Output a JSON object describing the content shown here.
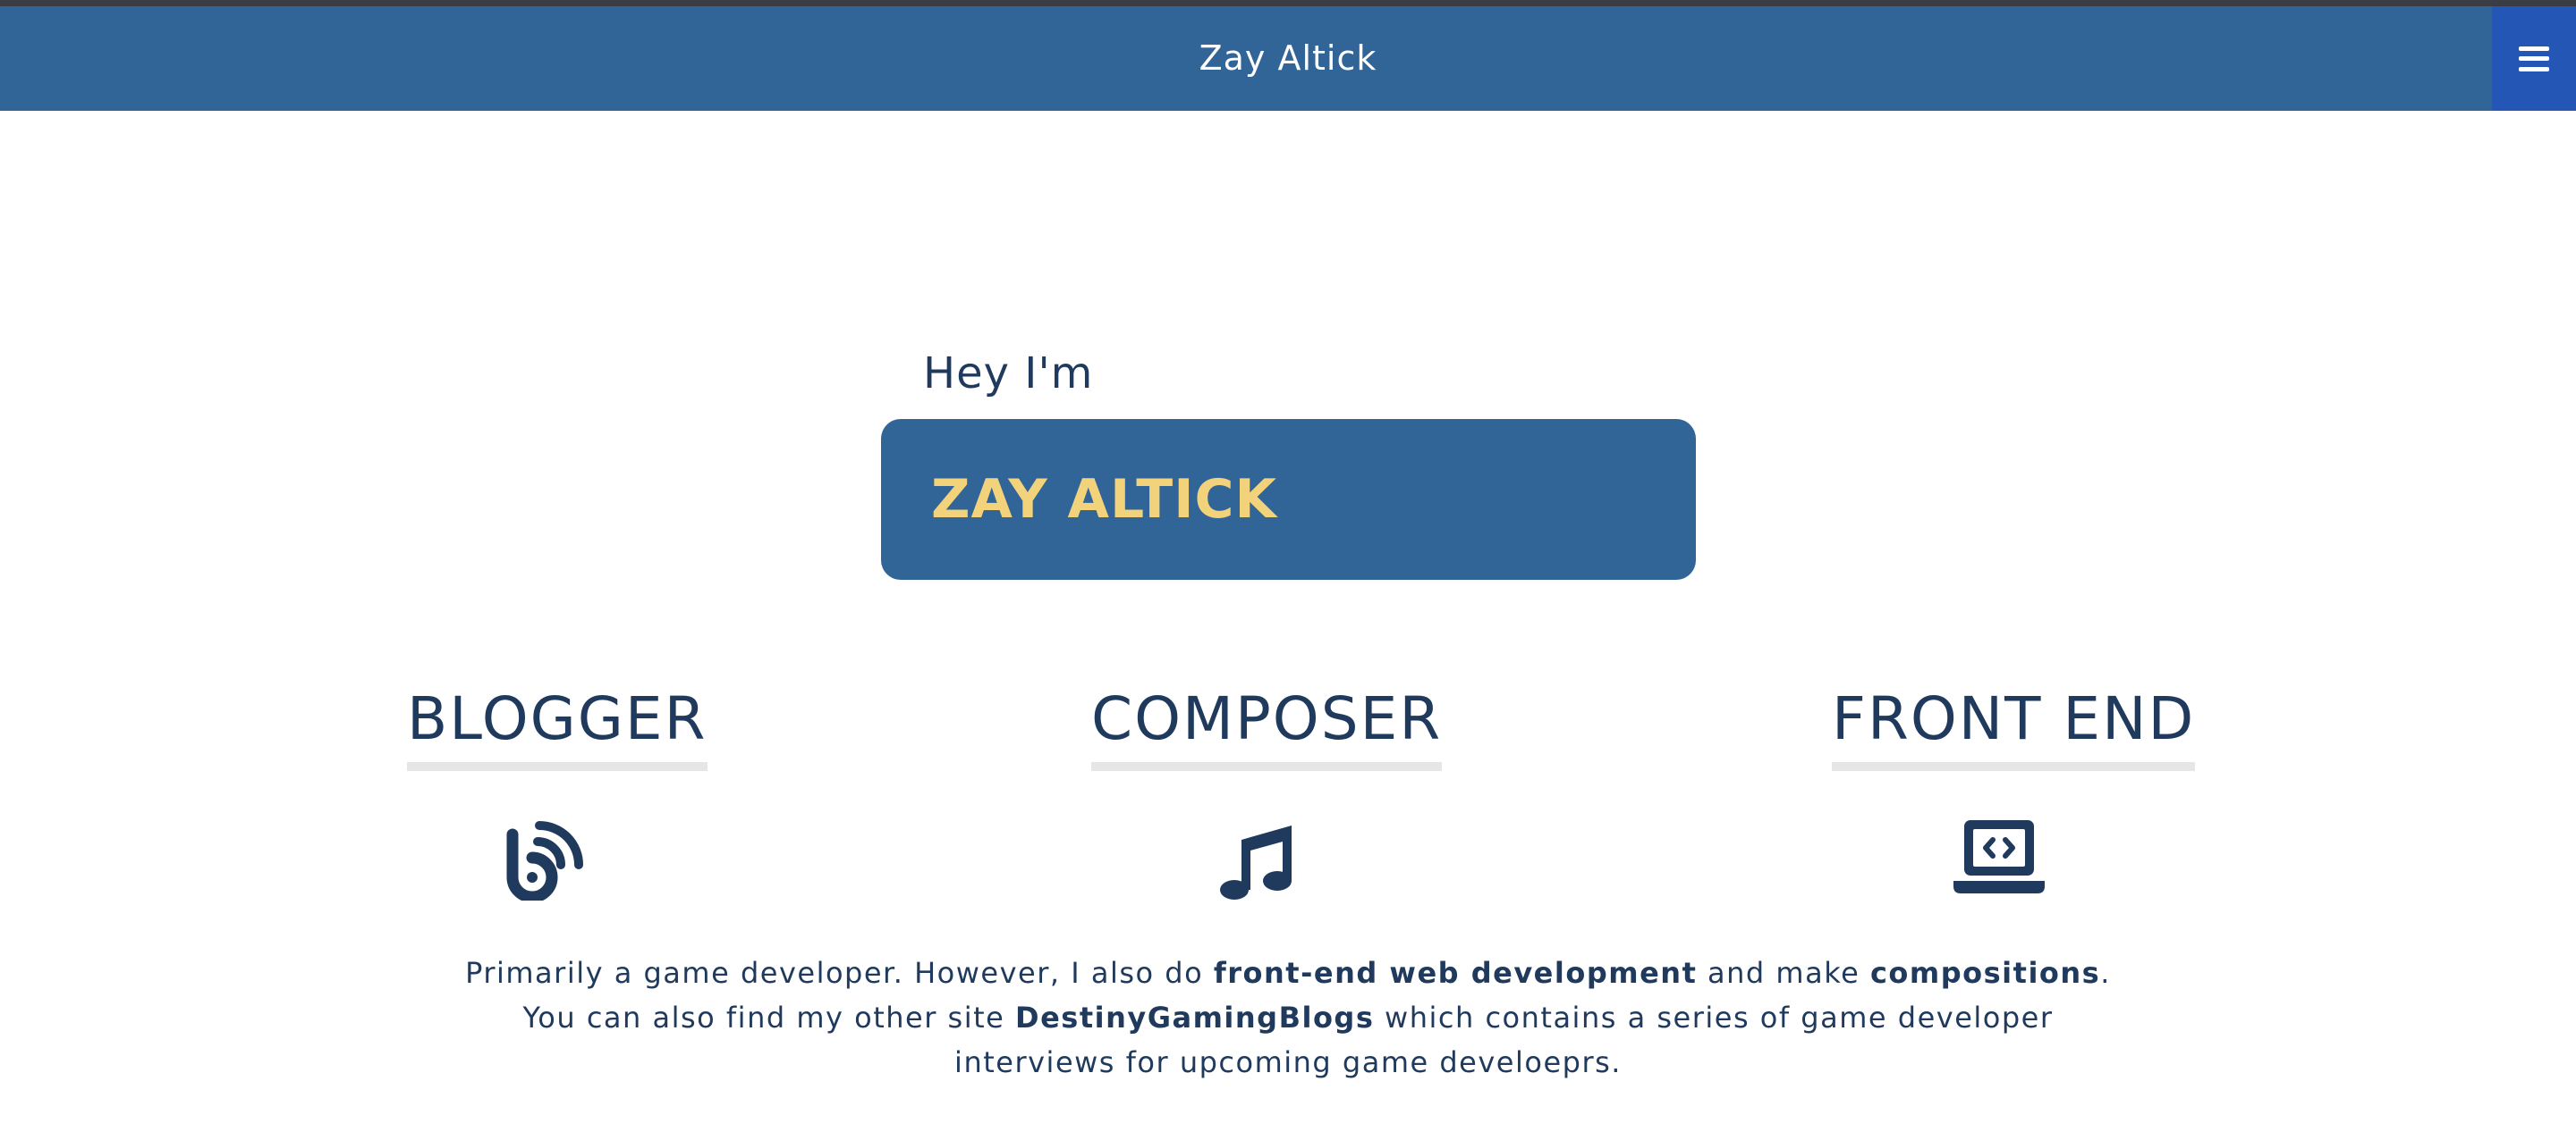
{
  "header": {
    "title": "Zay Altick",
    "menu_icon": "hamburger-menu-icon"
  },
  "hero": {
    "greeting": "Hey I'm",
    "name": "ZAY ALTICK"
  },
  "roles": [
    {
      "title": "BLOGGER",
      "icon": "blog-icon"
    },
    {
      "title": "COMPOSER",
      "icon": "music-note-icon"
    },
    {
      "title": "FRONT END",
      "icon": "laptop-code-icon"
    }
  ],
  "bio": {
    "part1": "Primarily a game developer. However, I also do ",
    "bold1": "front-end web development",
    "part2": " and make ",
    "bold2": "compositions",
    "part3": ". You can also find my other site ",
    "bold3": "DestinyGamingBlogs",
    "part4": " which contains a series of game developer interviews for upcoming game develoeprs."
  },
  "colors": {
    "navbar": "#316497",
    "menu_button": "#2457b5",
    "name_box": "#316497",
    "name_text": "#f2d27a",
    "text": "#1f3a5c",
    "underline": "#e6e6e6"
  }
}
